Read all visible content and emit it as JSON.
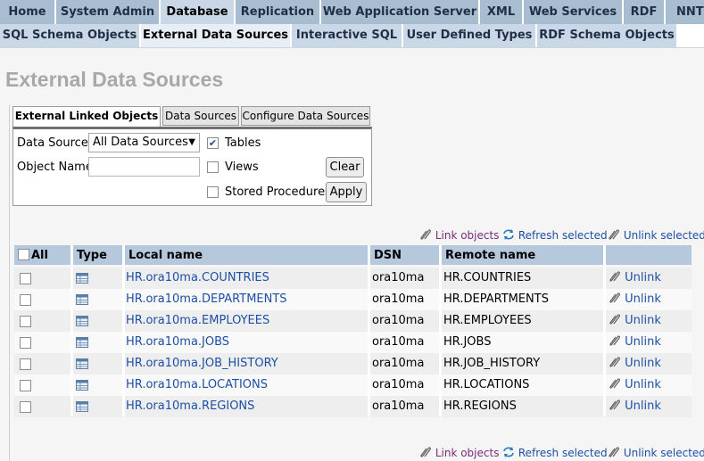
{
  "nav_primary": [
    "Home",
    "System Admin",
    "Database",
    "Replication",
    "Web Application Server",
    "XML",
    "Web Services",
    "RDF",
    "NNTP"
  ],
  "nav_secondary": [
    "SQL Schema Objects",
    "External Data Sources",
    "Interactive SQL",
    "User Defined Types",
    "RDF Schema Objects"
  ],
  "page_title": "External Data Sources",
  "subtabs": [
    "External Linked Objects",
    "Data Sources",
    "Configure Data Sources"
  ],
  "filters": {
    "data_source_label": "Data Source",
    "data_source_value": "All Data Sources",
    "object_name_label": "Object Name",
    "object_name_value": "",
    "tables_label": "Tables",
    "tables_checked": true,
    "views_label": "Views",
    "views_checked": false,
    "stored_procedures_label": "Stored Procedures",
    "stored_procedures_checked": false,
    "clear_button": "Clear",
    "apply_button": "Apply"
  },
  "actions": {
    "link_objects": "Link objects",
    "refresh_selected": "Refresh selected",
    "unlink_selected": "Unlink selected"
  },
  "table": {
    "columns": {
      "all": "All",
      "type": "Type",
      "local_name": "Local name",
      "dsn": "DSN",
      "remote_name": "Remote name"
    },
    "unlink_label": "Unlink",
    "rows": [
      {
        "local": "HR.ora10ma.COUNTRIES",
        "dsn": "ora10ma",
        "remote": "HR.COUNTRIES"
      },
      {
        "local": "HR.ora10ma.DEPARTMENTS",
        "dsn": "ora10ma",
        "remote": "HR.DEPARTMENTS"
      },
      {
        "local": "HR.ora10ma.EMPLOYEES",
        "dsn": "ora10ma",
        "remote": "HR.EMPLOYEES"
      },
      {
        "local": "HR.ora10ma.JOBS",
        "dsn": "ora10ma",
        "remote": "HR.JOBS"
      },
      {
        "local": "HR.ora10ma.JOB_HISTORY",
        "dsn": "ora10ma",
        "remote": "HR.JOB_HISTORY"
      },
      {
        "local": "HR.ora10ma.LOCATIONS",
        "dsn": "ora10ma",
        "remote": "HR.LOCATIONS"
      },
      {
        "local": "HR.ora10ma.REGIONS",
        "dsn": "ora10ma",
        "remote": "HR.REGIONS"
      }
    ]
  },
  "colors": {
    "nav_tab": "#a9bdd1",
    "nav_active": "#c9d7e6",
    "link": "#1d4fa6",
    "table_header": "#b6c9dc"
  }
}
